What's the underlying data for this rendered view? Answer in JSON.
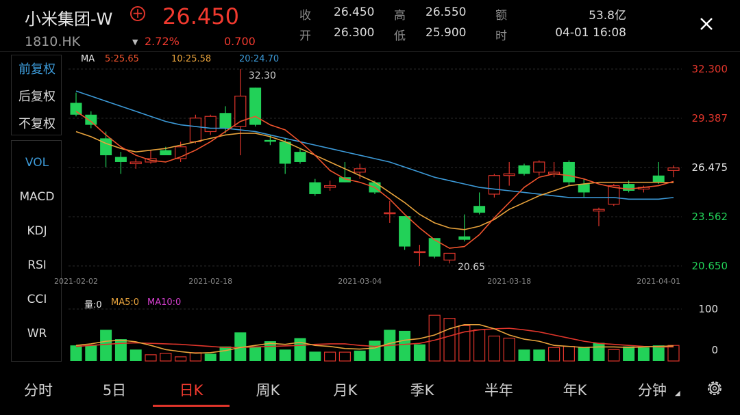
{
  "header": {
    "name": "小米集团-W",
    "code": "1810.HK",
    "price": "26.450",
    "change_pct": "2.72%",
    "change_amt": "0.700",
    "quote": [
      {
        "label": "收",
        "value": "26.450"
      },
      {
        "label": "高",
        "value": "26.550"
      },
      {
        "label": "额",
        "value": "53.8亿"
      },
      {
        "label": "开",
        "value": "26.300"
      },
      {
        "label": "低",
        "value": "25.900"
      },
      {
        "label": "时",
        "value": "04-01 16:08"
      }
    ]
  },
  "adjust_menu": [
    "前复权",
    "后复权",
    "不复权"
  ],
  "indicator_menu": [
    "VOL",
    "MACD",
    "KDJ",
    "RSI",
    "CCI",
    "WR"
  ],
  "ma_legend": {
    "label": "MA",
    "ma5": "5:25.65",
    "ma10": "10:25.58",
    "ma20": "20:24.70"
  },
  "vol_legend": {
    "label": "量:0",
    "ma5": "MA5:0",
    "ma10": "MA10:0"
  },
  "tabs": [
    "分时",
    "5日",
    "日K",
    "周K",
    "月K",
    "季K",
    "半年",
    "年K",
    "分钟"
  ],
  "active_tab": "日K",
  "colors": {
    "up": "#e0352b",
    "down": "#22d158",
    "ma5": "#f0532d",
    "ma10": "#e8a33c",
    "ma20": "#3c9ad8",
    "vol_ma10": "#d63fd0"
  },
  "chart_data": {
    "type": "candlestick",
    "y_axis_labels": [
      "32.300",
      "29.387",
      "26.475",
      "23.562",
      "20.650"
    ],
    "ylim": [
      20.65,
      32.3
    ],
    "x_labels": [
      {
        "label": "2021-02-02",
        "index": 0
      },
      {
        "label": "2021-02-18",
        "index": 9
      },
      {
        "label": "2021-03-04",
        "index": 19
      },
      {
        "label": "2021-03-18",
        "index": 29
      },
      {
        "label": "2021-04-01",
        "index": 39
      }
    ],
    "annotations": [
      {
        "label": "32.30",
        "index": 11,
        "value": 32.3
      },
      {
        "label": "20.65",
        "index": 25,
        "value": 20.65
      }
    ],
    "candles": [
      {
        "o": 30.3,
        "h": 30.9,
        "l": 29.5,
        "c": 29.6
      },
      {
        "o": 29.6,
        "h": 29.8,
        "l": 28.8,
        "c": 29.0
      },
      {
        "o": 28.2,
        "h": 28.6,
        "l": 26.5,
        "c": 27.2
      },
      {
        "o": 27.1,
        "h": 27.4,
        "l": 26.1,
        "c": 26.8
      },
      {
        "o": 26.7,
        "h": 27.0,
        "l": 26.4,
        "c": 26.8
      },
      {
        "o": 26.8,
        "h": 27.5,
        "l": 26.7,
        "c": 27.0
      },
      {
        "o": 27.5,
        "h": 27.7,
        "l": 27.3,
        "c": 27.2
      },
      {
        "o": 27.0,
        "h": 28.0,
        "l": 26.8,
        "c": 27.7
      },
      {
        "o": 28.0,
        "h": 29.6,
        "l": 27.9,
        "c": 29.4
      },
      {
        "o": 28.6,
        "h": 29.6,
        "l": 28.4,
        "c": 29.5
      },
      {
        "o": 29.7,
        "h": 30.1,
        "l": 28.5,
        "c": 28.8
      },
      {
        "o": 28.9,
        "h": 32.3,
        "l": 27.2,
        "c": 30.7
      },
      {
        "o": 31.2,
        "h": 31.2,
        "l": 28.9,
        "c": 29.0
      },
      {
        "o": 28.1,
        "h": 28.4,
        "l": 27.8,
        "c": 28.0
      },
      {
        "o": 28.0,
        "h": 28.2,
        "l": 26.1,
        "c": 26.7
      },
      {
        "o": 27.4,
        "h": 27.6,
        "l": 26.7,
        "c": 26.8
      },
      {
        "o": 25.6,
        "h": 25.8,
        "l": 24.8,
        "c": 24.9
      },
      {
        "o": 25.3,
        "h": 25.7,
        "l": 25.1,
        "c": 25.4
      },
      {
        "o": 25.9,
        "h": 26.8,
        "l": 25.6,
        "c": 25.6
      },
      {
        "o": 26.2,
        "h": 26.7,
        "l": 25.8,
        "c": 26.4
      },
      {
        "o": 25.6,
        "h": 25.7,
        "l": 24.9,
        "c": 25.0
      },
      {
        "o": 23.8,
        "h": 24.5,
        "l": 23.2,
        "c": 23.8
      },
      {
        "o": 23.6,
        "h": 23.6,
        "l": 21.6,
        "c": 21.8
      },
      {
        "o": 21.5,
        "h": 21.9,
        "l": 20.65,
        "c": 21.5
      },
      {
        "o": 22.3,
        "h": 22.3,
        "l": 21.1,
        "c": 21.2
      },
      {
        "o": 21.0,
        "h": 21.3,
        "l": 20.8,
        "c": 21.4
      },
      {
        "o": 22.4,
        "h": 23.7,
        "l": 22.1,
        "c": 22.2
      },
      {
        "o": 24.2,
        "h": 25.0,
        "l": 23.7,
        "c": 23.8
      },
      {
        "o": 24.9,
        "h": 26.1,
        "l": 24.7,
        "c": 26.0
      },
      {
        "o": 26.0,
        "h": 26.8,
        "l": 25.4,
        "c": 26.1
      },
      {
        "o": 26.6,
        "h": 26.7,
        "l": 26.0,
        "c": 26.1
      },
      {
        "o": 26.2,
        "h": 26.9,
        "l": 26.0,
        "c": 26.8
      },
      {
        "o": 26.1,
        "h": 26.8,
        "l": 25.9,
        "c": 26.2
      },
      {
        "o": 26.8,
        "h": 26.9,
        "l": 25.4,
        "c": 25.6
      },
      {
        "o": 25.5,
        "h": 25.8,
        "l": 24.7,
        "c": 25.0
      },
      {
        "o": 23.9,
        "h": 24.1,
        "l": 23.0,
        "c": 24.0
      },
      {
        "o": 24.3,
        "h": 25.5,
        "l": 24.2,
        "c": 25.4
      },
      {
        "o": 25.5,
        "h": 25.7,
        "l": 25.0,
        "c": 25.1
      },
      {
        "o": 25.2,
        "h": 25.4,
        "l": 25.0,
        "c": 25.3
      },
      {
        "o": 26.0,
        "h": 26.8,
        "l": 25.5,
        "c": 25.6
      },
      {
        "o": 26.3,
        "h": 26.6,
        "l": 25.9,
        "c": 26.45
      }
    ],
    "ma5": [
      29.8,
      29.2,
      28.4,
      27.7,
      27.2,
      26.9,
      26.8,
      27.1,
      27.5,
      28.0,
      28.6,
      29.2,
      29.5,
      29.0,
      28.7,
      28.0,
      27.2,
      26.3,
      25.8,
      25.6,
      25.3,
      24.6,
      23.7,
      22.9,
      22.2,
      21.7,
      21.8,
      22.5,
      23.5,
      24.4,
      25.3,
      25.9,
      26.1,
      26.0,
      25.8,
      25.5,
      25.3,
      25.2,
      25.3,
      25.4,
      25.65
    ],
    "ma10": [
      28.6,
      28.3,
      27.9,
      27.6,
      27.4,
      27.5,
      27.6,
      27.8,
      28.0,
      28.2,
      28.4,
      28.5,
      28.5,
      28.3,
      28.0,
      27.6,
      27.2,
      26.8,
      26.4,
      26.0,
      25.6,
      25.0,
      24.4,
      23.7,
      23.2,
      22.9,
      22.8,
      23.0,
      23.4,
      24.0,
      24.4,
      24.8,
      25.1,
      25.4,
      25.5,
      25.6,
      25.6,
      25.6,
      25.6,
      25.6,
      25.58
    ],
    "ma20": [
      31.0,
      30.7,
      30.4,
      30.1,
      29.8,
      29.5,
      29.2,
      29.0,
      28.9,
      28.8,
      28.8,
      28.7,
      28.6,
      28.4,
      28.2,
      28.0,
      27.8,
      27.6,
      27.4,
      27.2,
      27.0,
      26.8,
      26.5,
      26.2,
      25.9,
      25.7,
      25.5,
      25.3,
      25.2,
      25.1,
      25.0,
      24.9,
      24.8,
      24.7,
      24.7,
      24.7,
      24.7,
      24.6,
      24.6,
      24.6,
      24.7
    ],
    "volume_axis_labels": [
      "100",
      "0"
    ],
    "volume_ylim": [
      0,
      100
    ],
    "volume": [
      30,
      30,
      60,
      42,
      22,
      12,
      15,
      8,
      16,
      14,
      28,
      55,
      28,
      38,
      22,
      44,
      18,
      17,
      17,
      20,
      39,
      60,
      58,
      32,
      88,
      82,
      68,
      60,
      48,
      44,
      22,
      22,
      26,
      28,
      26,
      35,
      22,
      28,
      26,
      30,
      30
    ],
    "volume_up": [
      false,
      false,
      false,
      false,
      false,
      true,
      true,
      true,
      true,
      false,
      false,
      false,
      false,
      false,
      false,
      false,
      false,
      true,
      true,
      false,
      false,
      false,
      false,
      false,
      true,
      true,
      true,
      true,
      true,
      true,
      false,
      false,
      true,
      true,
      false,
      false,
      true,
      false,
      false,
      false,
      true
    ],
    "vol_ma5": [
      30,
      33,
      38,
      40,
      37,
      30,
      22,
      18,
      15,
      16,
      20,
      26,
      30,
      34,
      32,
      36,
      30,
      28,
      24,
      23,
      25,
      34,
      40,
      43,
      50,
      62,
      70,
      70,
      62,
      50,
      42,
      38,
      30,
      28,
      26,
      27,
      27,
      26,
      27,
      28,
      29
    ],
    "vol_ma10": [
      28,
      30,
      32,
      34,
      35,
      34,
      33,
      32,
      30,
      28,
      26,
      26,
      27,
      28,
      29,
      30,
      32,
      33,
      33,
      30,
      28,
      30,
      32,
      34,
      40,
      48,
      56,
      60,
      62,
      63,
      60,
      56,
      50,
      44,
      38,
      34,
      32,
      30,
      28,
      27,
      27
    ]
  }
}
